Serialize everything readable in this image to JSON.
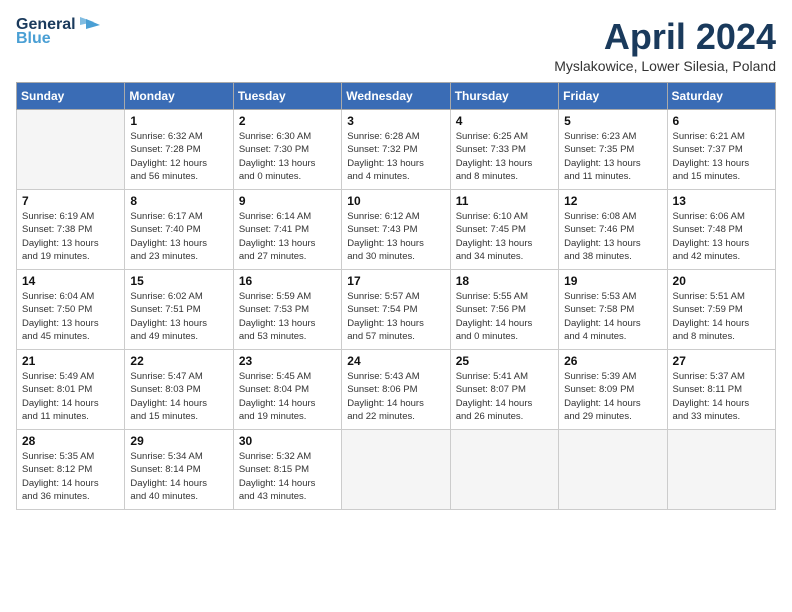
{
  "header": {
    "logo_line1": "General",
    "logo_line2": "Blue",
    "month_title": "April 2024",
    "location": "Myslakowice, Lower Silesia, Poland"
  },
  "columns": [
    "Sunday",
    "Monday",
    "Tuesday",
    "Wednesday",
    "Thursday",
    "Friday",
    "Saturday"
  ],
  "weeks": [
    [
      {
        "day": "",
        "info": ""
      },
      {
        "day": "1",
        "info": "Sunrise: 6:32 AM\nSunset: 7:28 PM\nDaylight: 12 hours\nand 56 minutes."
      },
      {
        "day": "2",
        "info": "Sunrise: 6:30 AM\nSunset: 7:30 PM\nDaylight: 13 hours\nand 0 minutes."
      },
      {
        "day": "3",
        "info": "Sunrise: 6:28 AM\nSunset: 7:32 PM\nDaylight: 13 hours\nand 4 minutes."
      },
      {
        "day": "4",
        "info": "Sunrise: 6:25 AM\nSunset: 7:33 PM\nDaylight: 13 hours\nand 8 minutes."
      },
      {
        "day": "5",
        "info": "Sunrise: 6:23 AM\nSunset: 7:35 PM\nDaylight: 13 hours\nand 11 minutes."
      },
      {
        "day": "6",
        "info": "Sunrise: 6:21 AM\nSunset: 7:37 PM\nDaylight: 13 hours\nand 15 minutes."
      }
    ],
    [
      {
        "day": "7",
        "info": "Sunrise: 6:19 AM\nSunset: 7:38 PM\nDaylight: 13 hours\nand 19 minutes."
      },
      {
        "day": "8",
        "info": "Sunrise: 6:17 AM\nSunset: 7:40 PM\nDaylight: 13 hours\nand 23 minutes."
      },
      {
        "day": "9",
        "info": "Sunrise: 6:14 AM\nSunset: 7:41 PM\nDaylight: 13 hours\nand 27 minutes."
      },
      {
        "day": "10",
        "info": "Sunrise: 6:12 AM\nSunset: 7:43 PM\nDaylight: 13 hours\nand 30 minutes."
      },
      {
        "day": "11",
        "info": "Sunrise: 6:10 AM\nSunset: 7:45 PM\nDaylight: 13 hours\nand 34 minutes."
      },
      {
        "day": "12",
        "info": "Sunrise: 6:08 AM\nSunset: 7:46 PM\nDaylight: 13 hours\nand 38 minutes."
      },
      {
        "day": "13",
        "info": "Sunrise: 6:06 AM\nSunset: 7:48 PM\nDaylight: 13 hours\nand 42 minutes."
      }
    ],
    [
      {
        "day": "14",
        "info": "Sunrise: 6:04 AM\nSunset: 7:50 PM\nDaylight: 13 hours\nand 45 minutes."
      },
      {
        "day": "15",
        "info": "Sunrise: 6:02 AM\nSunset: 7:51 PM\nDaylight: 13 hours\nand 49 minutes."
      },
      {
        "day": "16",
        "info": "Sunrise: 5:59 AM\nSunset: 7:53 PM\nDaylight: 13 hours\nand 53 minutes."
      },
      {
        "day": "17",
        "info": "Sunrise: 5:57 AM\nSunset: 7:54 PM\nDaylight: 13 hours\nand 57 minutes."
      },
      {
        "day": "18",
        "info": "Sunrise: 5:55 AM\nSunset: 7:56 PM\nDaylight: 14 hours\nand 0 minutes."
      },
      {
        "day": "19",
        "info": "Sunrise: 5:53 AM\nSunset: 7:58 PM\nDaylight: 14 hours\nand 4 minutes."
      },
      {
        "day": "20",
        "info": "Sunrise: 5:51 AM\nSunset: 7:59 PM\nDaylight: 14 hours\nand 8 minutes."
      }
    ],
    [
      {
        "day": "21",
        "info": "Sunrise: 5:49 AM\nSunset: 8:01 PM\nDaylight: 14 hours\nand 11 minutes."
      },
      {
        "day": "22",
        "info": "Sunrise: 5:47 AM\nSunset: 8:03 PM\nDaylight: 14 hours\nand 15 minutes."
      },
      {
        "day": "23",
        "info": "Sunrise: 5:45 AM\nSunset: 8:04 PM\nDaylight: 14 hours\nand 19 minutes."
      },
      {
        "day": "24",
        "info": "Sunrise: 5:43 AM\nSunset: 8:06 PM\nDaylight: 14 hours\nand 22 minutes."
      },
      {
        "day": "25",
        "info": "Sunrise: 5:41 AM\nSunset: 8:07 PM\nDaylight: 14 hours\nand 26 minutes."
      },
      {
        "day": "26",
        "info": "Sunrise: 5:39 AM\nSunset: 8:09 PM\nDaylight: 14 hours\nand 29 minutes."
      },
      {
        "day": "27",
        "info": "Sunrise: 5:37 AM\nSunset: 8:11 PM\nDaylight: 14 hours\nand 33 minutes."
      }
    ],
    [
      {
        "day": "28",
        "info": "Sunrise: 5:35 AM\nSunset: 8:12 PM\nDaylight: 14 hours\nand 36 minutes."
      },
      {
        "day": "29",
        "info": "Sunrise: 5:34 AM\nSunset: 8:14 PM\nDaylight: 14 hours\nand 40 minutes."
      },
      {
        "day": "30",
        "info": "Sunrise: 5:32 AM\nSunset: 8:15 PM\nDaylight: 14 hours\nand 43 minutes."
      },
      {
        "day": "",
        "info": ""
      },
      {
        "day": "",
        "info": ""
      },
      {
        "day": "",
        "info": ""
      },
      {
        "day": "",
        "info": ""
      }
    ]
  ]
}
